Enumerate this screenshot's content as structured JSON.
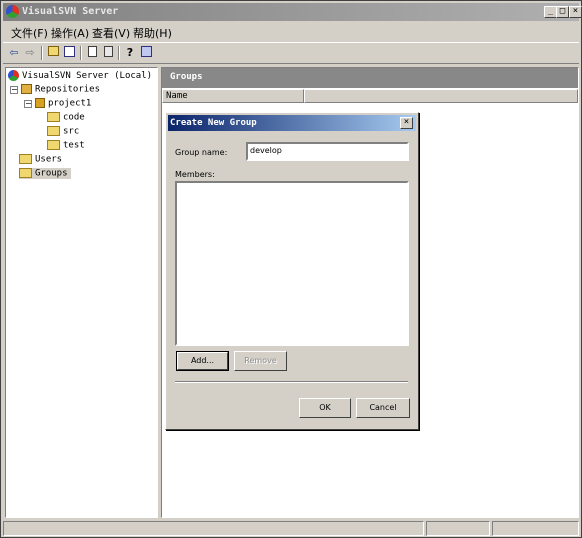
{
  "window": {
    "title": "VisualSVN Server"
  },
  "caption_buttons": {
    "minimize": "_",
    "maximize": "□",
    "close": "×"
  },
  "menu": [
    "文件(F)",
    "操作(A)",
    "查看(V)",
    "帮助(H)"
  ],
  "tree": {
    "root": "VisualSVN Server (Local)",
    "repositories": "Repositories",
    "project": "project1",
    "children": [
      "code",
      "src",
      "test"
    ],
    "users": "Users",
    "groups": "Groups",
    "expander": "−"
  },
  "panel": {
    "header": "Groups",
    "column_name": "Name"
  },
  "dialog": {
    "title": "Create New Group",
    "close": "×",
    "group_name_label": "Group name:",
    "group_name_value": "develop",
    "members_label": "Members:",
    "add_button": "Add...",
    "remove_button": "Remove",
    "ok_button": "OK",
    "cancel_button": "Cancel"
  },
  "icons": {
    "toolbar": [
      "back-arrow-icon",
      "forward-arrow-icon",
      "up-folder-icon",
      "show-tree-icon",
      "export-icon",
      "properties-icon",
      "help-icon",
      "console-icon"
    ]
  },
  "colors": {
    "dialog_title": "#0a246a",
    "folder": "#f0d870",
    "panel_header": "#888888"
  }
}
